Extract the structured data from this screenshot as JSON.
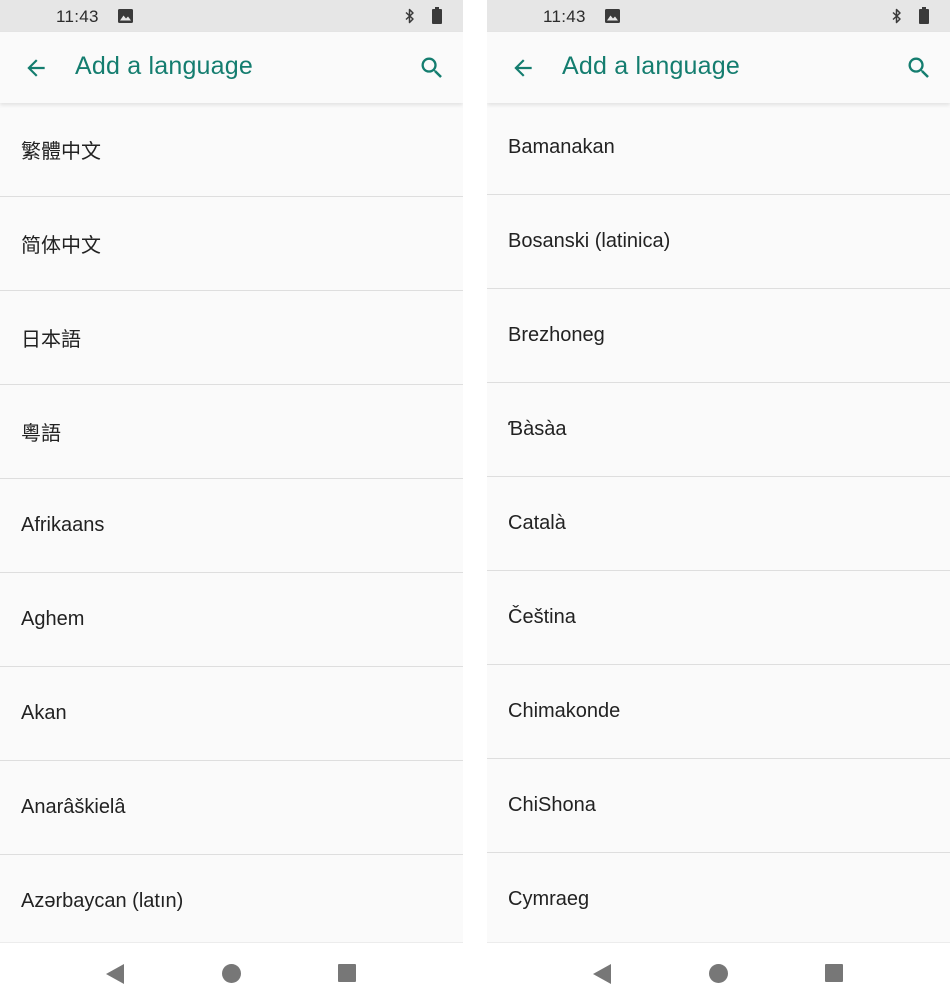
{
  "colors": {
    "accent": "#147d6f",
    "status_bar_bg": "#e6e6e6",
    "list_bg": "#fafafa",
    "divider": "#dedede",
    "nav_icon": "#777777",
    "text": "#222222"
  },
  "screens": [
    {
      "status_bar": {
        "time": "11:43",
        "icons": [
          "image-icon",
          "bluetooth-icon",
          "battery-icon"
        ]
      },
      "app_bar": {
        "back_icon": "arrow-back-icon",
        "title": "Add a language",
        "search_icon": "search-icon"
      },
      "languages": [
        "繁體中文",
        "简体中文",
        "日本語",
        "粵語",
        "Afrikaans",
        "Aghem",
        "Akan",
        "Anarâškielâ",
        "Azərbaycan (latın)"
      ],
      "nav_bar": {
        "icons": [
          "nav-back-icon",
          "nav-home-icon",
          "nav-recents-icon"
        ]
      }
    },
    {
      "status_bar": {
        "time": "11:43",
        "icons": [
          "image-icon",
          "bluetooth-icon",
          "battery-icon"
        ]
      },
      "app_bar": {
        "back_icon": "arrow-back-icon",
        "title": "Add a language",
        "search_icon": "search-icon"
      },
      "languages": [
        "Bamanakan",
        "Bosanski (latinica)",
        "Brezhoneg",
        "Ɓàsàa",
        "Català",
        "Čeština",
        "Chimakonde",
        "ChiShona",
        "Cymraeg"
      ],
      "nav_bar": {
        "icons": [
          "nav-back-icon",
          "nav-home-icon",
          "nav-recents-icon"
        ]
      }
    }
  ]
}
